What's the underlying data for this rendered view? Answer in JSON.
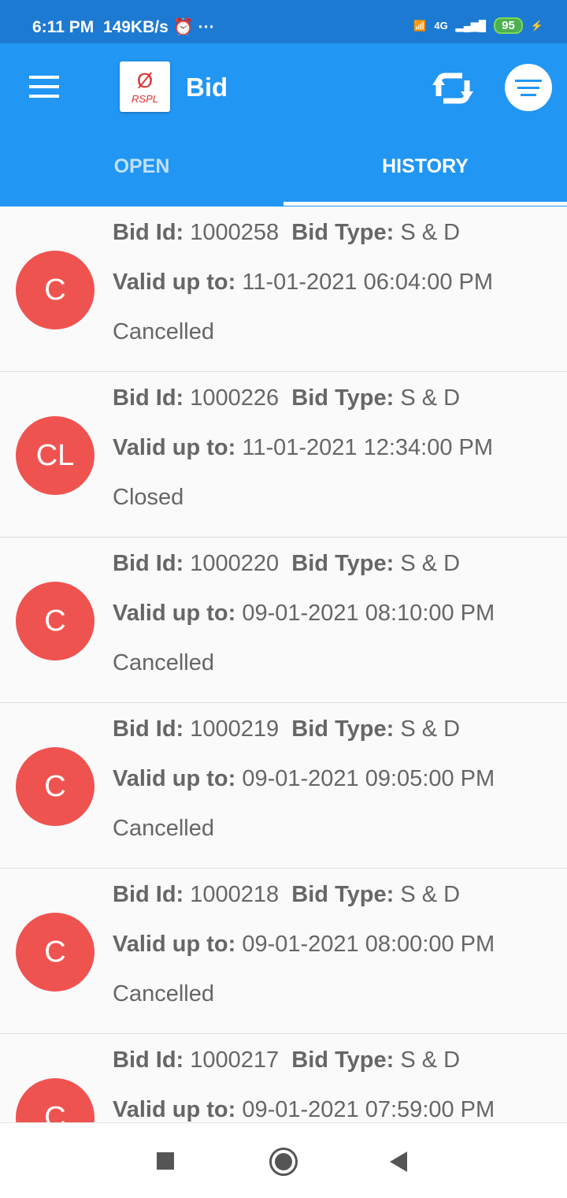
{
  "status": {
    "time": "6:11 PM",
    "speed": "149KB/s",
    "battery": "95",
    "network": "4G"
  },
  "appbar": {
    "title": "Bid",
    "logo_text": "RSPL"
  },
  "tabs": [
    {
      "label": "OPEN"
    },
    {
      "label": "HISTORY"
    }
  ],
  "labels": {
    "bid_id": "Bid Id:",
    "bid_type": "Bid Type:",
    "valid": "Valid up to:"
  },
  "items": [
    {
      "avatar": "C",
      "id": "1000258",
      "type": "S & D",
      "valid": "11-01-2021 06:04:00 PM",
      "status": "Cancelled"
    },
    {
      "avatar": "CL",
      "id": "1000226",
      "type": "S & D",
      "valid": "11-01-2021 12:34:00 PM",
      "status": "Closed"
    },
    {
      "avatar": "C",
      "id": "1000220",
      "type": "S & D",
      "valid": "09-01-2021 08:10:00 PM",
      "status": "Cancelled"
    },
    {
      "avatar": "C",
      "id": "1000219",
      "type": "S & D",
      "valid": "09-01-2021 09:05:00 PM",
      "status": "Cancelled"
    },
    {
      "avatar": "C",
      "id": "1000218",
      "type": "S & D",
      "valid": "09-01-2021 08:00:00 PM",
      "status": "Cancelled"
    },
    {
      "avatar": "C",
      "id": "1000217",
      "type": "S & D",
      "valid": "09-01-2021 07:59:00 PM",
      "status": ""
    }
  ],
  "colors": {
    "primary": "#2196f3",
    "avatar": "#ef5350"
  }
}
